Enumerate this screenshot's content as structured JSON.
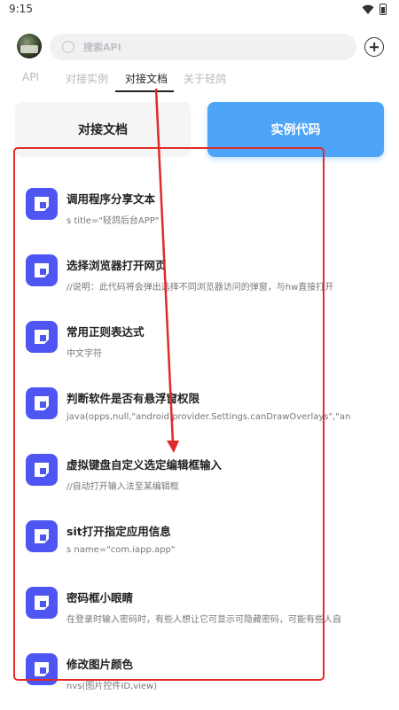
{
  "status_bar": {
    "time": "9:15"
  },
  "search": {
    "placeholder": "搜索API"
  },
  "tabs": [
    {
      "label": "API"
    },
    {
      "label": "对接实例"
    },
    {
      "label": "对接文档"
    },
    {
      "label": "关于轻鸽"
    }
  ],
  "active_tab": "对接文档",
  "buttons": {
    "docs_label": "对接文档",
    "code_label": "实例代码"
  },
  "items": [
    {
      "title": "调用程序分享文本",
      "subtitle": "s title=\"轻鸽后台APP\""
    },
    {
      "title": "选择浏览器打开网页",
      "subtitle": "//说明：此代码将会弹出选择不同浏览器访问的弹窗，与hw直接打开"
    },
    {
      "title": "常用正则表达式",
      "subtitle": "中文字符"
    },
    {
      "title": "判断软件是否有悬浮窗权限",
      "subtitle": "java(opps,null,\"android.provider.Settings.canDrawOverlays\",\"an"
    },
    {
      "title": "虚拟键盘自定义选定编辑框输入",
      "subtitle": "//自动打开输入法至某编辑框"
    },
    {
      "title": "sit打开指定应用信息",
      "subtitle": "s name=\"com.iapp.app\""
    },
    {
      "title": "密码框小眼睛",
      "subtitle": "在登录时输入密码时，有些人想让它可显示可隐藏密码，可能有些人自"
    },
    {
      "title": "修改图片颜色",
      "subtitle": "nvs(图片控件ID,view)"
    }
  ],
  "colors": {
    "accent": "#4ea4f6",
    "icon_bg": "#4e55f2",
    "annotation": "#e02b2b"
  }
}
